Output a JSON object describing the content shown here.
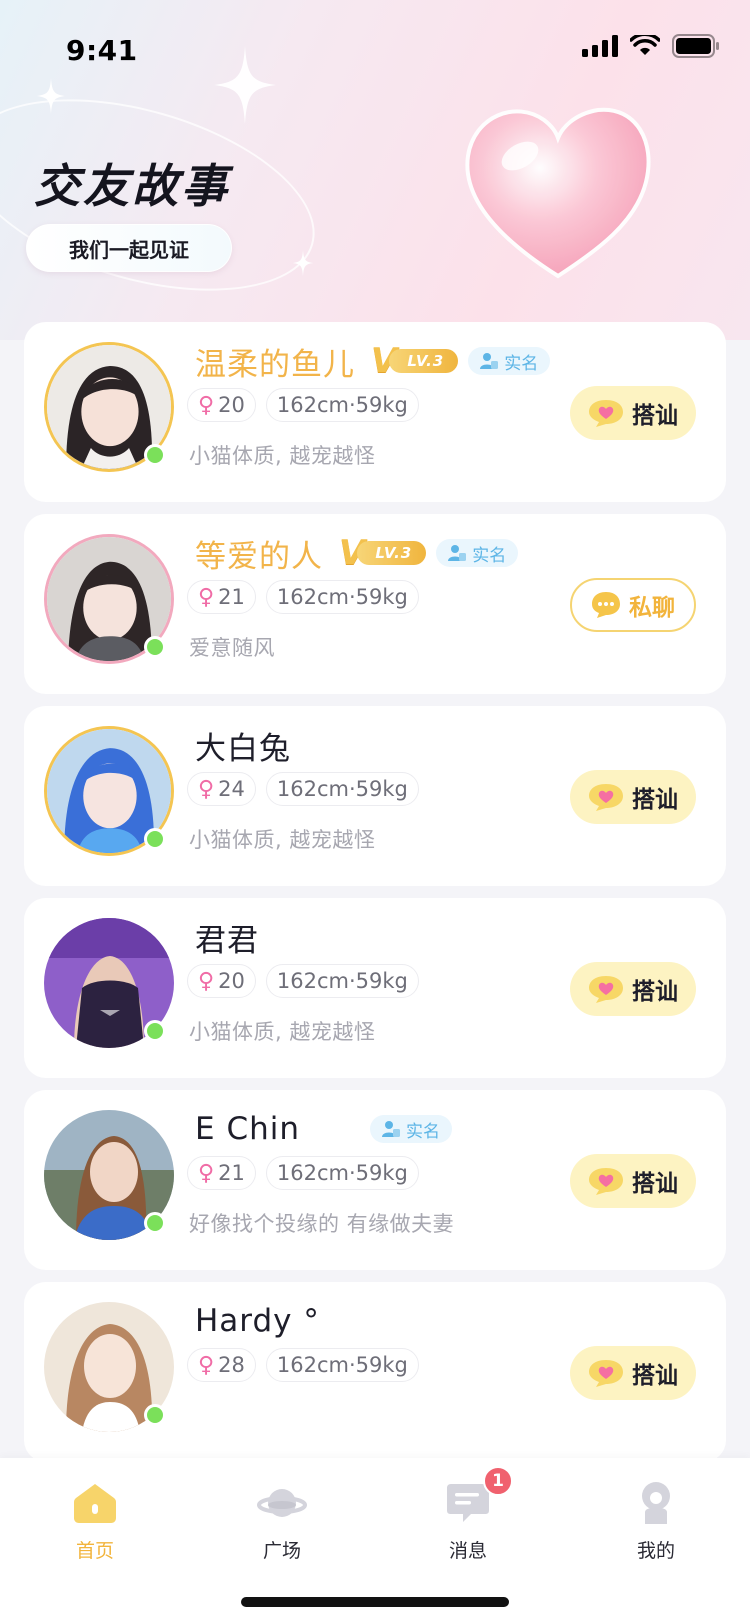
{
  "status_bar": {
    "time": "9:41"
  },
  "header": {
    "title": "交友故事",
    "pill": "我们一起见证"
  },
  "users": [
    {
      "name": "温柔的鱼儿",
      "vip": true,
      "level": "LV.3",
      "verified": true,
      "verify_label": "实名",
      "age": "20",
      "body": "162cm·59kg",
      "motto": "小猫体质, 越宠越怪",
      "action": "搭讪",
      "action_type": "flirt",
      "ring": "gold",
      "online": true
    },
    {
      "name": "等爱的人",
      "vip": true,
      "level": "LV.3",
      "verified": true,
      "verify_label": "实名",
      "age": "21",
      "body": "162cm·59kg",
      "motto": "爱意随风",
      "action": "私聊",
      "action_type": "chat",
      "ring": "pink",
      "online": true
    },
    {
      "name": "大白兔",
      "vip": false,
      "verified": false,
      "age": "24",
      "body": "162cm·59kg",
      "motto": "小猫体质, 越宠越怪",
      "action": "搭讪",
      "action_type": "flirt",
      "ring": "gold",
      "online": true
    },
    {
      "name": "君君",
      "vip": false,
      "verified": false,
      "age": "20",
      "body": "162cm·59kg",
      "motto": "小猫体质, 越宠越怪",
      "action": "搭讪",
      "action_type": "flirt",
      "ring": "none",
      "online": true
    },
    {
      "name": "E Chin",
      "vip": false,
      "verified": true,
      "verify_label": "实名",
      "age": "21",
      "body": "162cm·59kg",
      "motto": "好像找个投缘的 有缘做夫妻",
      "action": "搭讪",
      "action_type": "flirt",
      "ring": "none",
      "online": true
    },
    {
      "name": "Hardy °",
      "vip": false,
      "verified": false,
      "age": "28",
      "body": "162cm·59kg",
      "motto": "",
      "action": "搭讪",
      "action_type": "flirt",
      "ring": "none",
      "online": true
    }
  ],
  "tabbar": {
    "items": [
      {
        "label": "首页",
        "icon": "home-icon",
        "active": true
      },
      {
        "label": "广场",
        "icon": "planet-icon",
        "active": false
      },
      {
        "label": "消息",
        "icon": "message-icon",
        "active": false,
        "badge": "1"
      },
      {
        "label": "我的",
        "icon": "profile-icon",
        "active": false
      }
    ]
  },
  "colors": {
    "accent": "#F2B43C",
    "online": "#7BE05A",
    "badge": "#F0616E",
    "verify": "#5DB5E6"
  }
}
